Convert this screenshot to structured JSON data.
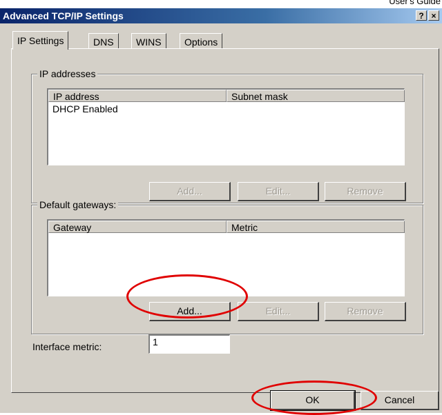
{
  "doc_header": "User's Guide",
  "window": {
    "title": "Advanced TCP/IP Settings",
    "help_label": "?",
    "close_label": "×"
  },
  "tabs": [
    {
      "label": "IP Settings",
      "active": true
    },
    {
      "label": "DNS",
      "active": false
    },
    {
      "label": "WINS",
      "active": false
    },
    {
      "label": "Options",
      "active": false
    }
  ],
  "ip_addresses": {
    "group_label": "IP addresses",
    "columns": [
      "IP address",
      "Subnet mask"
    ],
    "rows": [
      "DHCP Enabled"
    ],
    "buttons": {
      "add": "Add...",
      "edit": "Edit...",
      "remove": "Remove"
    }
  },
  "default_gateways": {
    "group_label": "Default gateways:",
    "columns": [
      "Gateway",
      "Metric"
    ],
    "rows": [],
    "buttons": {
      "add": "Add...",
      "edit": "Edit...",
      "remove": "Remove"
    }
  },
  "interface_metric": {
    "label": "Interface metric:",
    "value": "1"
  },
  "footer": {
    "ok_label": "OK",
    "cancel_label": "Cancel"
  },
  "annotation_color": "#e00000"
}
